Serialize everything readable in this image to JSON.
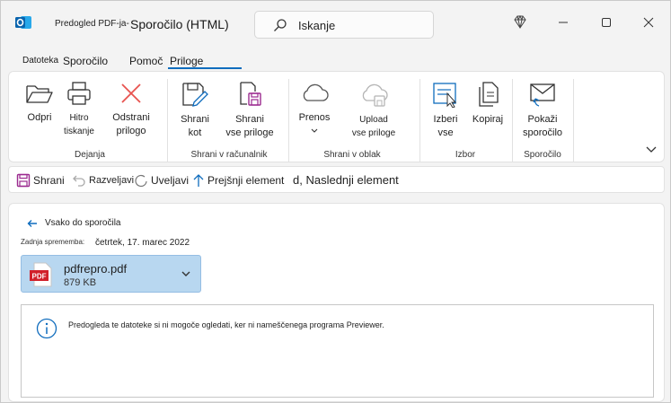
{
  "titlebar": {
    "app_icon": "outlook-icon",
    "small_title": "Predogled PDF-ja-",
    "main_title": "Sporočilo (HTML)",
    "search_placeholder": "Iskanje",
    "search_icon": "search-icon",
    "controls": [
      "diamond-icon",
      "minimize-icon",
      "maximize-icon",
      "close-icon"
    ]
  },
  "tabs": {
    "datoteka": "Datoteka",
    "sporocilo": "Sporočilo",
    "pomoc": "Pomoč",
    "priloge": "Priloge"
  },
  "ribbon": {
    "open": "Odpri",
    "quick_print_1": "Hitro",
    "quick_print_2": "tiskanje",
    "remove_1": "Odstrani",
    "remove_2": "prilogo",
    "group_actions": "Dejanja",
    "save_as_1": "Shrani",
    "save_as_2": "kot",
    "save_all_1": "Shrani",
    "save_all_2": "vse priloge",
    "group_save_pc": "Shrani v računalnik",
    "transfer": "Prenos",
    "upload_1": "Upload",
    "upload_2": "vse priloge",
    "group_save_cloud": "Shrani v oblak",
    "select_all_1": "Izberi",
    "select_all_2": "vse",
    "copy": "Kopiraj",
    "group_select": "Izbor",
    "show_msg_1": "Pokaži",
    "show_msg_2": "sporočilo",
    "group_message": "Sporočilo"
  },
  "qbar": {
    "save": "Shrani",
    "undo": "Razveljavi",
    "redo": "Uveljavi",
    "prev": "Prejšnji element",
    "next": "d, Naslednji element"
  },
  "pane": {
    "back": "Vsako do sporočila",
    "modified_label": "Zadnja sprememba:",
    "modified_date": "četrtek, 17. marec 2022",
    "file_name": "pdfrepro.pdf",
    "file_size": "879 KB",
    "notice": "Predogleda te datoteke si ni mogoče ogledati, ker ni nameščenega programa Previewer."
  },
  "colors": {
    "accent": "#0f6cbd",
    "attachment_bg": "#b8d7f0",
    "remove_icon": "#e8534f",
    "pdf_red": "#d1202a",
    "save_purple": "#9b2a8f"
  }
}
